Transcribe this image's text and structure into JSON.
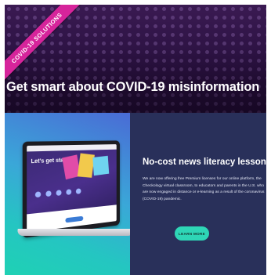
{
  "hero": {
    "ribbon_label": "COVID-19 SOLUTIONS",
    "title": "Get smart about COVID-19 misinformation"
  },
  "promo": {
    "laptop_screen_text": "Let's get started",
    "title": "No-cost news literacy lessons",
    "body": "We are now offering free Premium licenses for our online platform, the Checkology virtual classroom, to educators and parents in the U.S. who are now engaged in distance or e-learning as a result of the coronavirus (COVID-19) pandemic.",
    "button_label": "LEARN MORE"
  },
  "colors": {
    "ribbon": "#d6249b",
    "hero_bg": "#2a1140",
    "promo_right_bg": "#29305a",
    "button": "#2ed6b6"
  }
}
